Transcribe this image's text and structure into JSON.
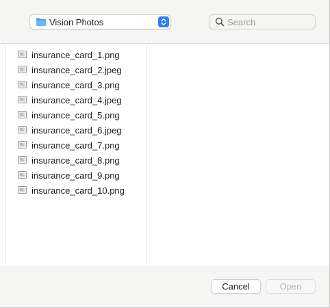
{
  "toolbar": {
    "location": "Vision Photos",
    "location_icon": "folder-icon",
    "search_placeholder": "Search",
    "search_value": ""
  },
  "files": [
    {
      "name": "insurance_card_1.png",
      "icon": "image-file-icon"
    },
    {
      "name": "insurance_card_2.jpeg",
      "icon": "image-file-icon"
    },
    {
      "name": "insurance_card_3.png",
      "icon": "image-file-icon"
    },
    {
      "name": "insurance_card_4.jpeg",
      "icon": "image-file-icon"
    },
    {
      "name": "insurance_card_5.png",
      "icon": "image-file-icon"
    },
    {
      "name": "insurance_card_6.jpeg",
      "icon": "image-file-icon"
    },
    {
      "name": "insurance_card_7.png",
      "icon": "image-file-icon"
    },
    {
      "name": "insurance_card_8.png",
      "icon": "image-file-icon"
    },
    {
      "name": "insurance_card_9.png",
      "icon": "image-file-icon"
    },
    {
      "name": "insurance_card_10.png",
      "icon": "image-file-icon"
    }
  ],
  "footer": {
    "cancel_label": "Cancel",
    "open_label": "Open",
    "open_enabled": false
  },
  "colors": {
    "accent": "#2f7bf6",
    "folder": "#4aa3f0"
  }
}
